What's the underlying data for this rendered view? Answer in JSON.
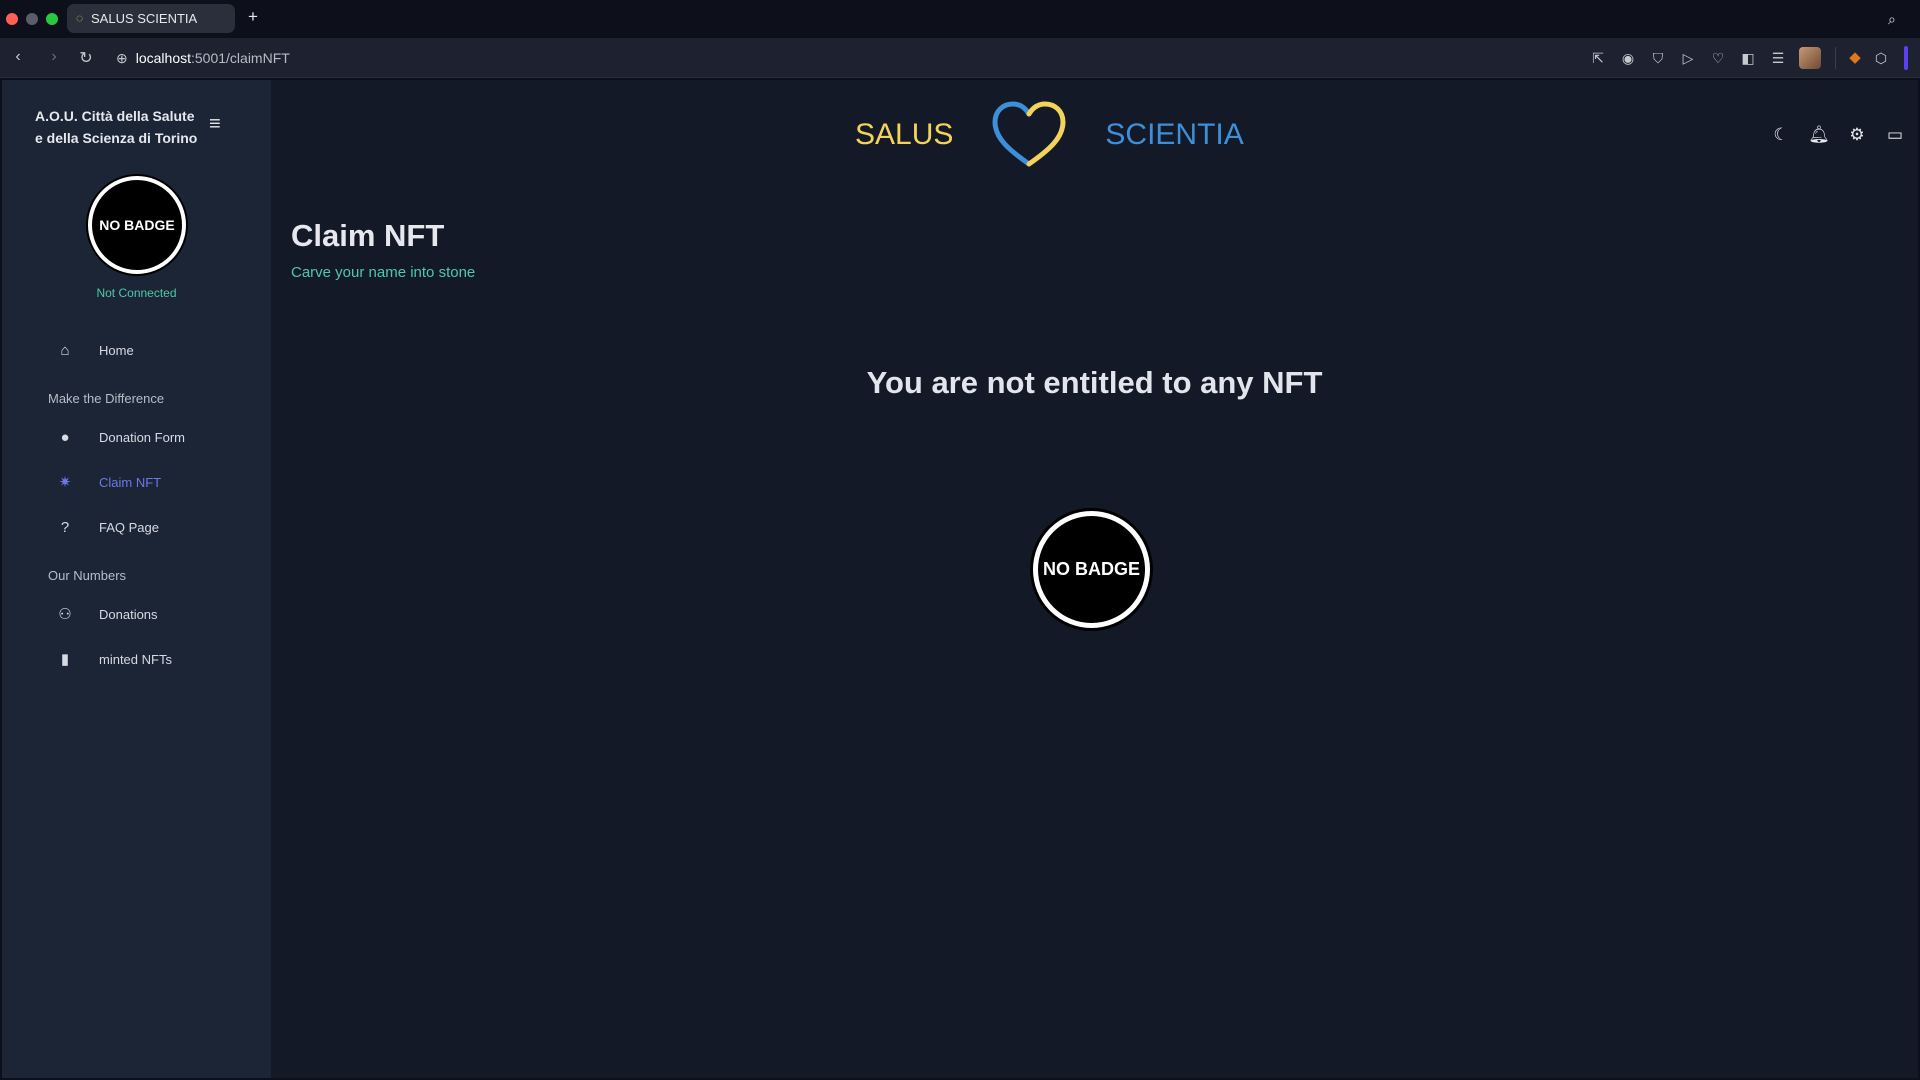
{
  "browser": {
    "tab_title": "SALUS SCIENTIA",
    "url_host": "localhost",
    "url_path": ":5001/claimNFT"
  },
  "sidebar": {
    "org_line1": "A.O.U. Città della Salute",
    "org_line2": "e della Scienza di Torino",
    "badge_label": "NO BADGE",
    "connection_status": "Not Connected",
    "home_label": "Home",
    "section1": "Make the Difference",
    "items1": [
      {
        "label": "Donation Form",
        "icon": "person-icon"
      },
      {
        "label": "Claim NFT",
        "icon": "party-popper-icon",
        "active": true
      },
      {
        "label": "FAQ Page",
        "icon": "help-circle-icon"
      }
    ],
    "section2": "Our Numbers",
    "items2": [
      {
        "label": "Donations",
        "icon": "people-icon"
      },
      {
        "label": "minted NFTs",
        "icon": "bar-chart-icon"
      }
    ]
  },
  "header": {
    "brand_left": "SALUS",
    "brand_right": "SCIENTIA"
  },
  "main": {
    "title": "Claim NFT",
    "subtitle": "Carve your name into stone",
    "empty_message": "You are not entitled to any NFT",
    "badge_label": "NO BADGE"
  },
  "colors": {
    "accent": "#6c78e8",
    "teal": "#4cc9a8",
    "brand_yellow": "#f3d35a",
    "brand_blue": "#3c8fd8"
  }
}
